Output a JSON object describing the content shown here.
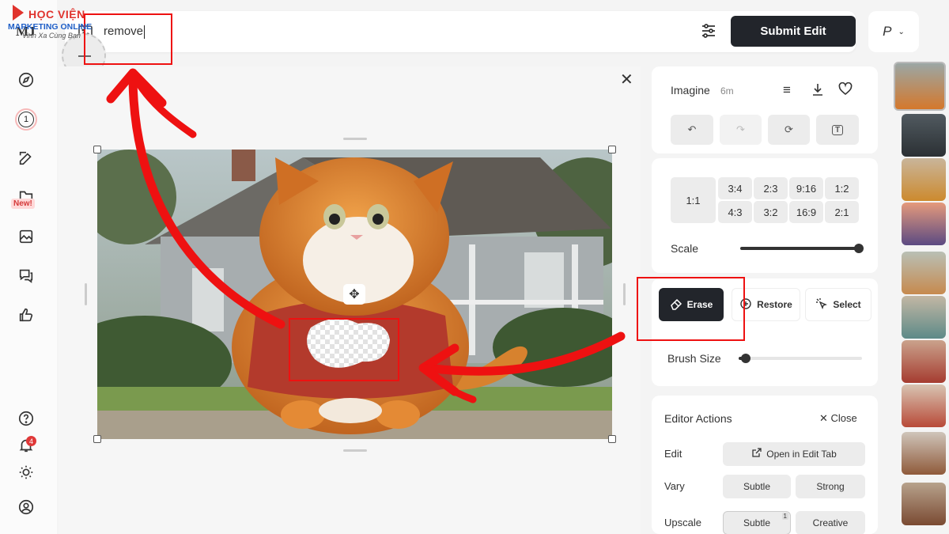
{
  "watermark": {
    "line1": "HỌC VIỆN",
    "line2": "MARKETING ONLINE",
    "line3": "Vinh Xa Cùng Bạn"
  },
  "rail": {
    "logo": "MJ",
    "queue_count": "1",
    "new_label": "New!",
    "notification_count": "4"
  },
  "topbar": {
    "prompt_value": "remove",
    "submit_label": "Submit Edit",
    "profile_initial": "P"
  },
  "panel": {
    "title": "Imagine",
    "age": "6m",
    "ratios_left": "1:1",
    "ratios": [
      "3:4",
      "2:3",
      "9:16",
      "1:2",
      "4:3",
      "3:2",
      "16:9",
      "2:1"
    ],
    "scale_label": "Scale",
    "scale_value": 1.0,
    "tools": {
      "erase": "Erase",
      "restore": "Restore",
      "select": "Select"
    },
    "brush_label": "Brush Size",
    "brush_value": 0.06,
    "editor_title": "Editor Actions",
    "close_label": "Close",
    "edit_label": "Edit",
    "open_edit_tab": "Open in Edit Tab",
    "vary_label": "Vary",
    "subtle": "Subtle",
    "strong": "Strong",
    "upscale_label": "Upscale",
    "upscale_subtle": "Subtle",
    "upscale_creative": "Creative",
    "upscale_badge": "1"
  },
  "colors": {
    "accent_dark": "#22252b",
    "annotation_red": "#e11111",
    "cat_orange": "#d9782a",
    "shirt_red": "#b33a2c"
  }
}
